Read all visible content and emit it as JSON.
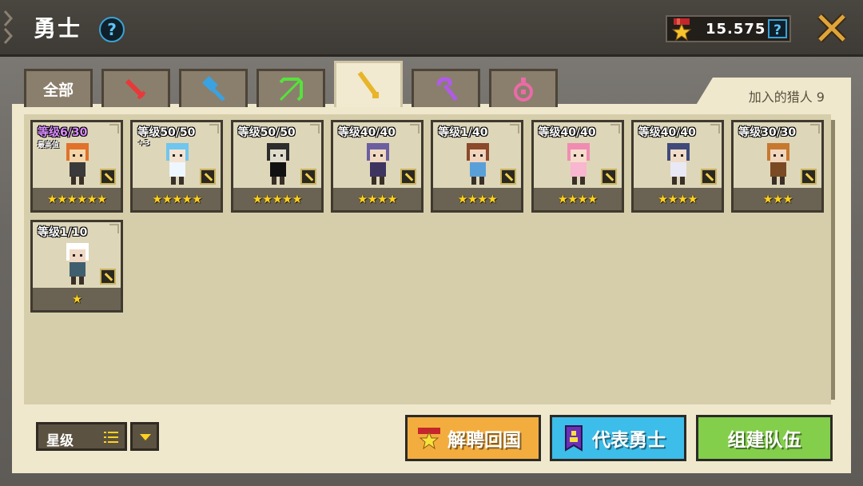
{
  "header": {
    "title": "勇士",
    "currency_amount": "15.575",
    "help_glyph": "?"
  },
  "tabs": [
    {
      "label": "全部",
      "icon": "all",
      "active": false
    },
    {
      "label": "",
      "icon": "sword-icon",
      "color": "#e8393a",
      "active": false
    },
    {
      "label": "",
      "icon": "hammer-icon",
      "color": "#3aa2e0",
      "active": false
    },
    {
      "label": "",
      "icon": "bow-icon",
      "color": "#56e23c",
      "active": false
    },
    {
      "label": "",
      "icon": "gun-icon",
      "color": "#e8b42a",
      "active": true
    },
    {
      "label": "",
      "icon": "staff-icon",
      "color": "#b05be8",
      "active": false
    },
    {
      "label": "",
      "icon": "amulet-icon",
      "color": "#ec6aa8",
      "active": false
    }
  ],
  "roster": {
    "joined_label": "加入的猎人 9",
    "cards": [
      {
        "level": "等级6/30",
        "note": "最高值",
        "stars": "★★★★★★",
        "star_count": 6,
        "highlight": true
      },
      {
        "level": "等级50/50",
        "note": "+3",
        "stars": "★★★★★",
        "star_count": 5
      },
      {
        "level": "等级50/50",
        "stars": "★★★★★",
        "star_count": 5
      },
      {
        "level": "等级40/40",
        "stars": "★★★★",
        "star_count": 4
      },
      {
        "level": "等级1/40",
        "stars": "★★★★",
        "star_count": 4
      },
      {
        "level": "等级40/40",
        "stars": "★★★★",
        "star_count": 4
      },
      {
        "level": "等级40/40",
        "stars": "★★★★",
        "star_count": 4
      },
      {
        "level": "等级30/30",
        "stars": "★★★",
        "star_count": 3
      },
      {
        "level": "等级1/10",
        "stars": "★",
        "star_count": 1
      }
    ]
  },
  "footer": {
    "sort_label": "星级",
    "dismiss_label": "解聘回国",
    "representative_label": "代表勇士",
    "team_label": "组建队伍"
  },
  "colors": {
    "accent_gold": "#ffd21e",
    "dismiss": "#f3ad3f",
    "representative": "#3dbde9",
    "team": "#83cf4c"
  }
}
